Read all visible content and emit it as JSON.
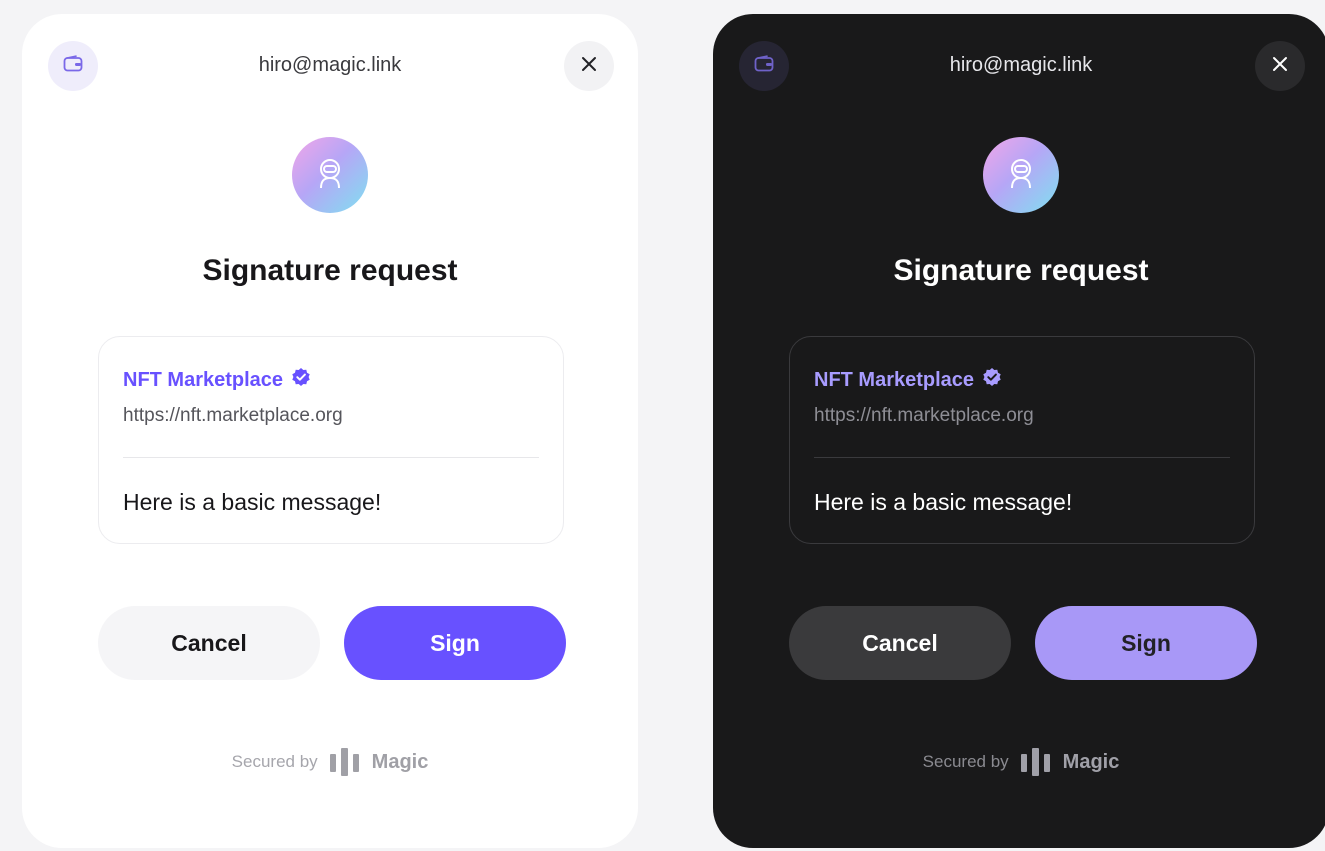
{
  "colors": {
    "light_accent": "#6851ff",
    "dark_accent": "#a898f7",
    "dark_background": "#19191a",
    "light_background": "#ffffff"
  },
  "icons": {
    "header_left": "wallet-icon",
    "header_right": "close-icon",
    "avatar": "astronaut-icon",
    "verified": "verified-badge-icon",
    "brand": "magic-logo-icon"
  },
  "light": {
    "email": "hiro@magic.link",
    "title": "Signature request",
    "app_name": "NFT Marketplace",
    "app_url": "https://nft.marketplace.org",
    "message": "Here is a basic message!",
    "cancel_label": "Cancel",
    "sign_label": "Sign",
    "secured_by": "Secured by",
    "brand": "Magic"
  },
  "dark": {
    "email": "hiro@magic.link",
    "title": "Signature request",
    "app_name": "NFT Marketplace",
    "app_url": "https://nft.marketplace.org",
    "message": "Here is a basic message!",
    "cancel_label": "Cancel",
    "sign_label": "Sign",
    "secured_by": "Secured by",
    "brand": "Magic"
  }
}
